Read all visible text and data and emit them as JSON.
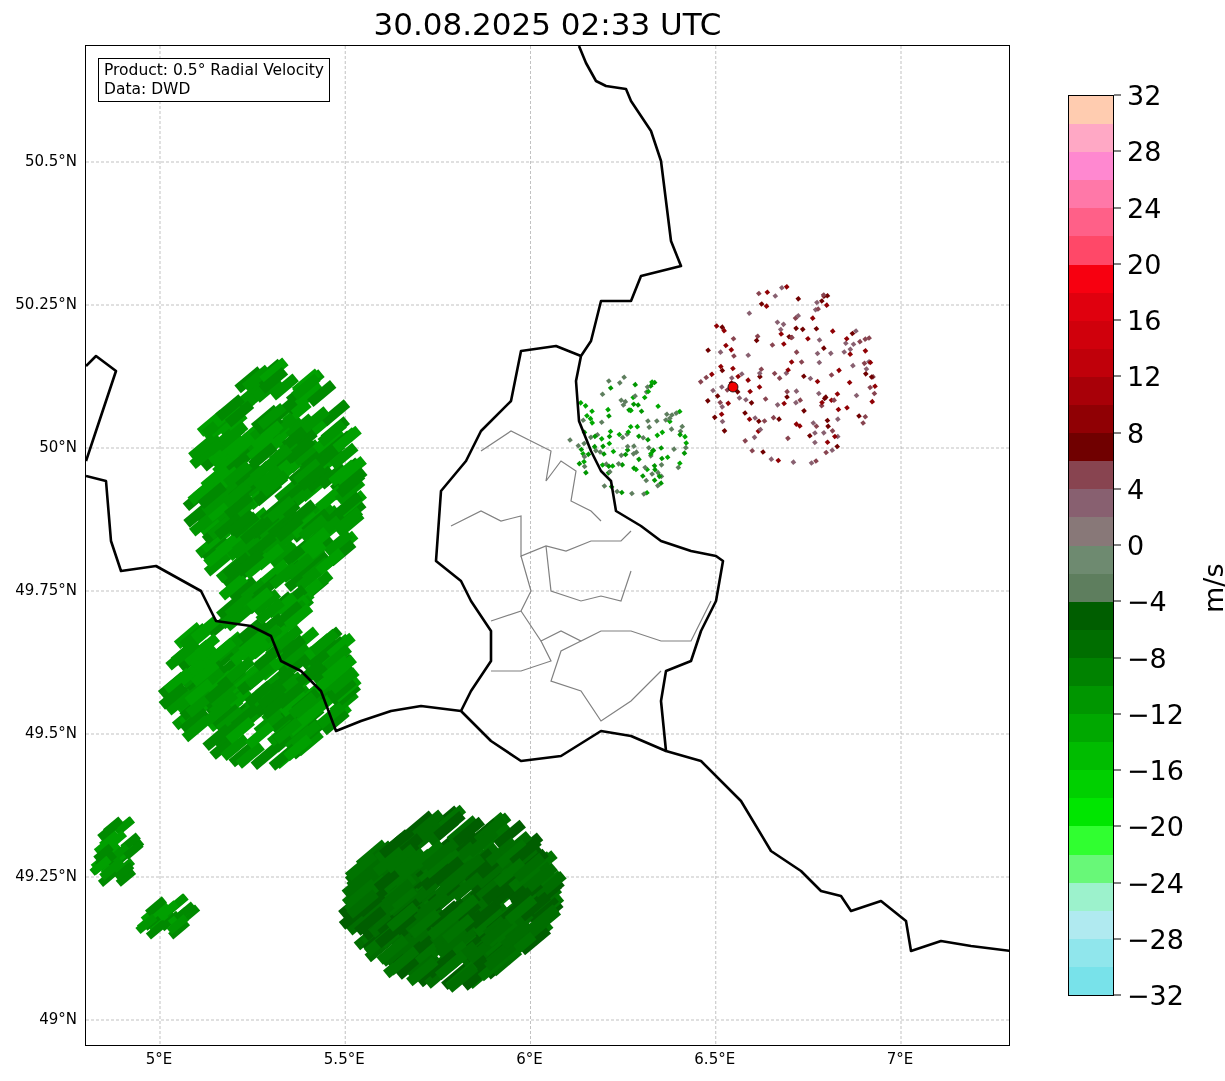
{
  "title": "30.08.2025 02:33 UTC",
  "map": {
    "info_box": [
      "Product: 0.5° Radial Velocity",
      "Data: DWD"
    ],
    "lat_ticks": [
      "50.5°N",
      "50.25°N",
      "50°N",
      "49.75°N",
      "49.5°N",
      "49.25°N",
      "49°N"
    ],
    "lon_ticks": [
      "5°E",
      "5.5°E",
      "6°E",
      "6.5°E",
      "7°E"
    ]
  },
  "colorbar": {
    "label": "m/s",
    "ticks": [
      "32",
      "28",
      "24",
      "20",
      "16",
      "12",
      "8",
      "4",
      "0",
      "−4",
      "−8",
      "−12",
      "−16",
      "−20",
      "−24",
      "−28",
      "−32"
    ],
    "segments": [
      {
        "color": "#ffccb0"
      },
      {
        "color": "#ffa8c5"
      },
      {
        "color": "#ff88d0"
      },
      {
        "color": "#ff78a8"
      },
      {
        "color": "#ff6088"
      },
      {
        "color": "#ff4868"
      },
      {
        "color": "#f70010"
      },
      {
        "color": "#e0000e"
      },
      {
        "color": "#d0000c"
      },
      {
        "color": "#c0000a"
      },
      {
        "color": "#a80008"
      },
      {
        "color": "#900004"
      },
      {
        "color": "#700000"
      },
      {
        "color": "#884450"
      },
      {
        "color": "#886070"
      },
      {
        "color": "#887878"
      },
      {
        "color": "#6e8a70"
      },
      {
        "color": "#5e7e5e"
      },
      {
        "color": "#005e00"
      },
      {
        "color": "#006e00"
      },
      {
        "color": "#008200"
      },
      {
        "color": "#009600"
      },
      {
        "color": "#00a800"
      },
      {
        "color": "#00bc00"
      },
      {
        "color": "#00d000"
      },
      {
        "color": "#00e600"
      },
      {
        "color": "#30ff30"
      },
      {
        "color": "#68f878"
      },
      {
        "color": "#9cf2cc"
      },
      {
        "color": "#b0eaf0"
      },
      {
        "color": "#90e6ec"
      },
      {
        "color": "#78e2ea"
      }
    ]
  }
}
